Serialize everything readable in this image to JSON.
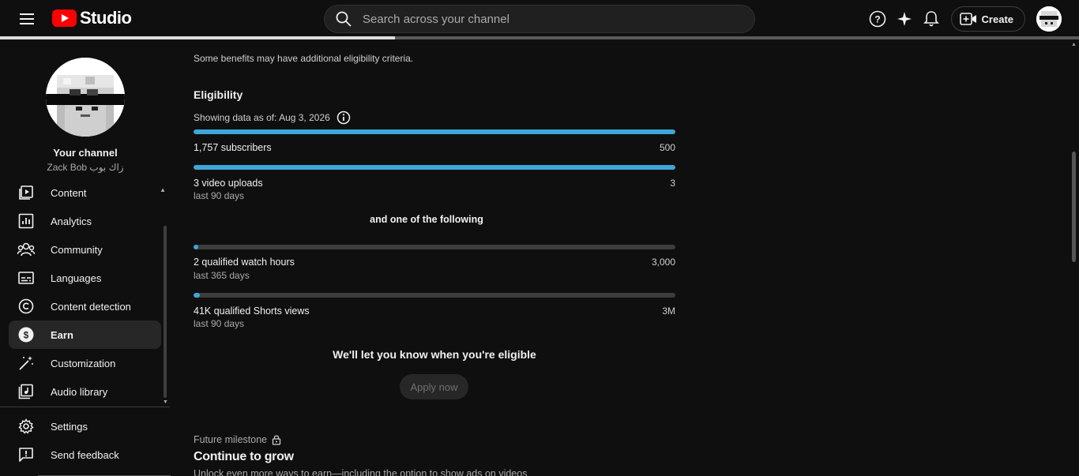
{
  "header": {
    "logo_text": "Studio",
    "search_placeholder": "Search across your channel",
    "create_label": "Create"
  },
  "sidebar": {
    "channel_title": "Your channel",
    "channel_name": "Zack Bob زاك بوب",
    "items": [
      {
        "label": "Content",
        "icon": "content-icon"
      },
      {
        "label": "Analytics",
        "icon": "analytics-icon"
      },
      {
        "label": "Community",
        "icon": "community-icon"
      },
      {
        "label": "Languages",
        "icon": "subtitles-icon"
      },
      {
        "label": "Content detection",
        "icon": "copyright-icon"
      },
      {
        "label": "Earn",
        "icon": "dollar-icon",
        "active": true
      },
      {
        "label": "Customization",
        "icon": "magic-wand-icon"
      },
      {
        "label": "Audio library",
        "icon": "audio-library-icon"
      }
    ],
    "bottom_items": [
      {
        "label": "Settings",
        "icon": "gear-icon"
      },
      {
        "label": "Send feedback",
        "icon": "feedback-icon"
      }
    ]
  },
  "main": {
    "note": "Some benefits may have additional eligibility criteria.",
    "eligibility_title": "Eligibility",
    "as_of": "Showing data as of: Aug 3, 2026",
    "requirements": [
      {
        "label": "1,757 subscribers",
        "sub": "",
        "target": "500",
        "progress": 1.0
      },
      {
        "label": "3 video uploads",
        "sub": "last 90 days",
        "target": "3",
        "progress": 1.0
      }
    ],
    "or_text": "and one of the following",
    "alternatives": [
      {
        "label": "2 qualified watch hours",
        "sub": "last 365 days",
        "target": "3,000",
        "progress": 0.0007
      },
      {
        "label": "41K qualified Shorts views",
        "sub": "last 90 days",
        "target": "3M",
        "progress": 0.0137
      }
    ],
    "notify_text": "We'll let you know when you're eligible",
    "apply_label": "Apply now",
    "future_label": "Future milestone",
    "grow_title": "Continue to grow",
    "grow_desc": "Unlock even more ways to earn—including the option to show ads on videos"
  },
  "colors": {
    "accent": "#3ea6d9",
    "background": "#0f0f0f",
    "active_nav": "#272727",
    "brand_red": "#ff0000"
  }
}
